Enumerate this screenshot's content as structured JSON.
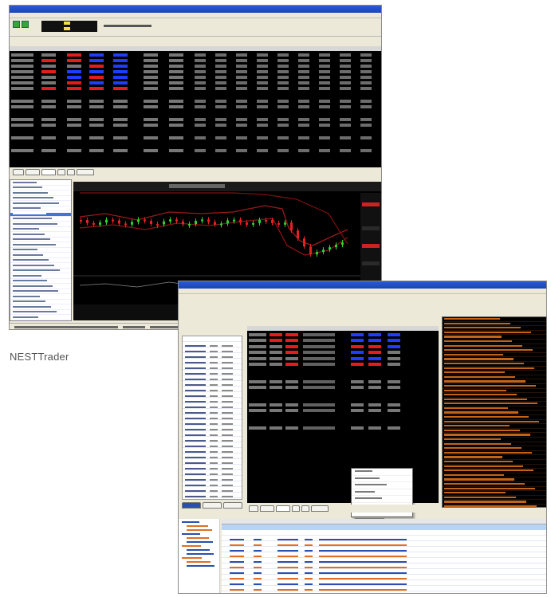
{
  "caption": {
    "label": "NESTTrader"
  },
  "screenshot_top": {
    "window_title": "",
    "tabs": [
      "",
      "",
      "",
      "",
      "",
      ""
    ],
    "status_bar": ""
  },
  "screenshot_bottom": {
    "tabs": [
      "",
      "",
      "",
      "",
      "",
      ""
    ],
    "context_menu_items": [
      "",
      "",
      "",
      "",
      "",
      "",
      "",
      "",
      ""
    ]
  },
  "colors": {
    "title_bar": "#1846b4",
    "watch_background": "#000000",
    "sell_highlight": "#e51c1c",
    "buy_highlight": "#1f3cff",
    "chart_candle_up": "#2fd02f",
    "chart_candle_down": "#e52222",
    "log_text": "#c46419",
    "selection": "#3a78d6"
  }
}
